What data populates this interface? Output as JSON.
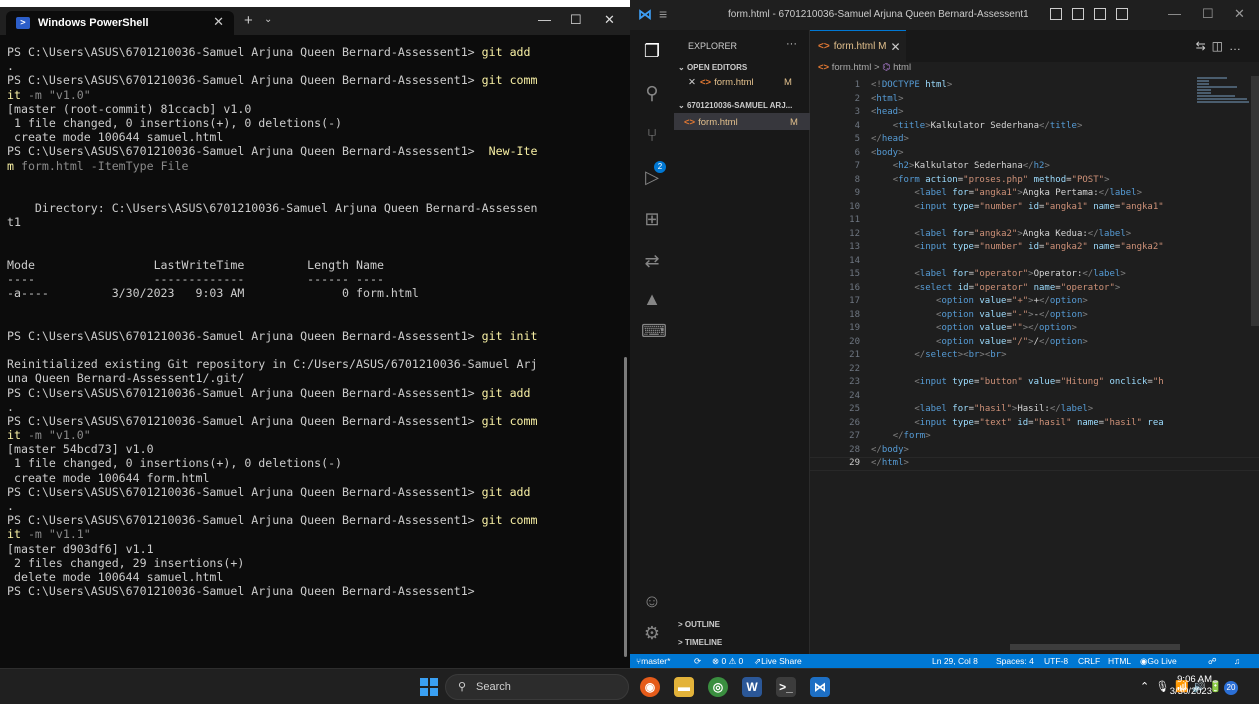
{
  "powershell": {
    "tab_title": "Windows PowerShell",
    "lines": [
      {
        "text": "PS C:\\Users\\ASUS\\6701210036-Samuel Arjuna Queen Bernard-Assessent1> ",
        "cmd": "git add",
        "arg": ""
      },
      {
        "text": ".",
        "cmd": "",
        "arg": ""
      },
      {
        "text": "PS C:\\Users\\ASUS\\6701210036-Samuel Arjuna Queen Bernard-Assessent1> ",
        "cmd": "git comm",
        "arg": ""
      },
      {
        "text": "",
        "cmd": "it",
        "arg": " -m \"v1.0\""
      },
      {
        "text": "[master (root-commit) 81ccacb] v1.0",
        "cmd": "",
        "arg": ""
      },
      {
        "text": " 1 file changed, 0 insertions(+), 0 deletions(-)",
        "cmd": "",
        "arg": ""
      },
      {
        "text": " create mode 100644 samuel.html",
        "cmd": "",
        "arg": ""
      },
      {
        "text": "PS C:\\Users\\ASUS\\6701210036-Samuel Arjuna Queen Bernard-Assessent1> ",
        "cmd": " New-Ite",
        "arg": ""
      },
      {
        "text": "",
        "cmd": "m",
        "arg": " form.html -ItemType File"
      },
      {
        "text": "",
        "cmd": "",
        "arg": ""
      },
      {
        "text": "",
        "cmd": "",
        "arg": ""
      },
      {
        "text": "    Directory: C:\\Users\\ASUS\\6701210036-Samuel Arjuna Queen Bernard-Assessen",
        "cmd": "",
        "arg": ""
      },
      {
        "text": "t1",
        "cmd": "",
        "arg": ""
      },
      {
        "text": "",
        "cmd": "",
        "arg": ""
      },
      {
        "text": "",
        "cmd": "",
        "arg": ""
      },
      {
        "text": "Mode                 LastWriteTime         Length Name",
        "cmd": "",
        "arg": ""
      },
      {
        "text": "----                 -------------         ------ ----",
        "cmd": "",
        "arg": ""
      },
      {
        "text": "-a----         3/30/2023   9:03 AM              0 form.html",
        "cmd": "",
        "arg": ""
      },
      {
        "text": "",
        "cmd": "",
        "arg": ""
      },
      {
        "text": "",
        "cmd": "",
        "arg": ""
      },
      {
        "text": "PS C:\\Users\\ASUS\\6701210036-Samuel Arjuna Queen Bernard-Assessent1> ",
        "cmd": "git init",
        "arg": ""
      },
      {
        "text": "",
        "cmd": "",
        "arg": ""
      },
      {
        "text": "Reinitialized existing Git repository in C:/Users/ASUS/6701210036-Samuel Arj",
        "cmd": "",
        "arg": ""
      },
      {
        "text": "una Queen Bernard-Assessent1/.git/",
        "cmd": "",
        "arg": ""
      },
      {
        "text": "PS C:\\Users\\ASUS\\6701210036-Samuel Arjuna Queen Bernard-Assessent1> ",
        "cmd": "git add",
        "arg": ""
      },
      {
        "text": ".",
        "cmd": "",
        "arg": ""
      },
      {
        "text": "PS C:\\Users\\ASUS\\6701210036-Samuel Arjuna Queen Bernard-Assessent1> ",
        "cmd": "git comm",
        "arg": ""
      },
      {
        "text": "",
        "cmd": "it",
        "arg": " -m \"v1.0\""
      },
      {
        "text": "[master 54bcd73] v1.0",
        "cmd": "",
        "arg": ""
      },
      {
        "text": " 1 file changed, 0 insertions(+), 0 deletions(-)",
        "cmd": "",
        "arg": ""
      },
      {
        "text": " create mode 100644 form.html",
        "cmd": "",
        "arg": ""
      },
      {
        "text": "PS C:\\Users\\ASUS\\6701210036-Samuel Arjuna Queen Bernard-Assessent1> ",
        "cmd": "git add",
        "arg": ""
      },
      {
        "text": ".",
        "cmd": "",
        "arg": ""
      },
      {
        "text": "PS C:\\Users\\ASUS\\6701210036-Samuel Arjuna Queen Bernard-Assessent1> ",
        "cmd": "git comm",
        "arg": ""
      },
      {
        "text": "",
        "cmd": "it",
        "arg": " -m \"v1.1\""
      },
      {
        "text": "[master d903df6] v1.1",
        "cmd": "",
        "arg": ""
      },
      {
        "text": " 2 files changed, 29 insertions(+)",
        "cmd": "",
        "arg": ""
      },
      {
        "text": " delete mode 100644 samuel.html",
        "cmd": "",
        "arg": ""
      },
      {
        "text": "PS C:\\Users\\ASUS\\6701210036-Samuel Arjuna Queen Bernard-Assessent1>",
        "cmd": "",
        "arg": ""
      }
    ]
  },
  "vscode": {
    "window_title": "form.html - 6701210036-Samuel Arjuna Queen Bernard-Assessent1 - ...",
    "explorer_title": "EXPLORER",
    "explorer_more": "···",
    "open_editors": "OPEN EDITORS",
    "folder": "6701210036-SAMUEL ARJ...",
    "open_file": "form.html",
    "open_file_status": "M",
    "folder_file": "form.html",
    "folder_file_status": "M",
    "tab_label": "form.html M",
    "breadcrumb_file": "form.html",
    "breadcrumb_sep": ">",
    "breadcrumb_node": "html",
    "outline": "OUTLINE",
    "timeline": "TIMELINE",
    "scm_badge": "2",
    "code_lines": [
      [
        [
          "n",
          "<!"
        ],
        [
          "t",
          "DOCTYPE"
        ],
        [
          "a",
          " html"
        ],
        [
          "n",
          ">"
        ]
      ],
      [
        [
          "n",
          "<"
        ],
        [
          "t",
          "html"
        ],
        [
          "n",
          ">"
        ]
      ],
      [
        [
          "n",
          "<"
        ],
        [
          "t",
          "head"
        ],
        [
          "n",
          ">"
        ]
      ],
      [
        [
          "tx",
          "    "
        ],
        [
          "n",
          "<"
        ],
        [
          "t",
          "title"
        ],
        [
          "n",
          ">"
        ],
        [
          "tx",
          "Kalkulator Sederhana"
        ],
        [
          "n",
          "</"
        ],
        [
          "t",
          "title"
        ],
        [
          "n",
          ">"
        ]
      ],
      [
        [
          "n",
          "</"
        ],
        [
          "t",
          "head"
        ],
        [
          "n",
          ">"
        ]
      ],
      [
        [
          "n",
          "<"
        ],
        [
          "t",
          "body"
        ],
        [
          "n",
          ">"
        ]
      ],
      [
        [
          "tx",
          "    "
        ],
        [
          "n",
          "<"
        ],
        [
          "t",
          "h2"
        ],
        [
          "n",
          ">"
        ],
        [
          "tx",
          "Kalkulator Sederhana"
        ],
        [
          "n",
          "</"
        ],
        [
          "t",
          "h2"
        ],
        [
          "n",
          ">"
        ]
      ],
      [
        [
          "tx",
          "    "
        ],
        [
          "n",
          "<"
        ],
        [
          "t",
          "form"
        ],
        [
          "a",
          " action"
        ],
        [
          "tx",
          "="
        ],
        [
          "s",
          "\"proses.php\""
        ],
        [
          "a",
          " method"
        ],
        [
          "tx",
          "="
        ],
        [
          "s",
          "\"POST\""
        ],
        [
          "n",
          ">"
        ]
      ],
      [
        [
          "tx",
          "        "
        ],
        [
          "n",
          "<"
        ],
        [
          "t",
          "label"
        ],
        [
          "a",
          " for"
        ],
        [
          "tx",
          "="
        ],
        [
          "s",
          "\"angka1\""
        ],
        [
          "n",
          ">"
        ],
        [
          "tx",
          "Angka Pertama:"
        ],
        [
          "n",
          "</"
        ],
        [
          "t",
          "label"
        ],
        [
          "n",
          ">"
        ]
      ],
      [
        [
          "tx",
          "        "
        ],
        [
          "n",
          "<"
        ],
        [
          "t",
          "input"
        ],
        [
          "a",
          " type"
        ],
        [
          "tx",
          "="
        ],
        [
          "s",
          "\"number\""
        ],
        [
          "a",
          " id"
        ],
        [
          "tx",
          "="
        ],
        [
          "s",
          "\"angka1\""
        ],
        [
          "a",
          " name"
        ],
        [
          "tx",
          "="
        ],
        [
          "s",
          "\"angka1\""
        ]
      ],
      [
        [
          "tx",
          ""
        ]
      ],
      [
        [
          "tx",
          "        "
        ],
        [
          "n",
          "<"
        ],
        [
          "t",
          "label"
        ],
        [
          "a",
          " for"
        ],
        [
          "tx",
          "="
        ],
        [
          "s",
          "\"angka2\""
        ],
        [
          "n",
          ">"
        ],
        [
          "tx",
          "Angka Kedua:"
        ],
        [
          "n",
          "</"
        ],
        [
          "t",
          "label"
        ],
        [
          "n",
          ">"
        ]
      ],
      [
        [
          "tx",
          "        "
        ],
        [
          "n",
          "<"
        ],
        [
          "t",
          "input"
        ],
        [
          "a",
          " type"
        ],
        [
          "tx",
          "="
        ],
        [
          "s",
          "\"number\""
        ],
        [
          "a",
          " id"
        ],
        [
          "tx",
          "="
        ],
        [
          "s",
          "\"angka2\""
        ],
        [
          "a",
          " name"
        ],
        [
          "tx",
          "="
        ],
        [
          "s",
          "\"angka2\""
        ]
      ],
      [
        [
          "tx",
          ""
        ]
      ],
      [
        [
          "tx",
          "        "
        ],
        [
          "n",
          "<"
        ],
        [
          "t",
          "label"
        ],
        [
          "a",
          " for"
        ],
        [
          "tx",
          "="
        ],
        [
          "s",
          "\"operator\""
        ],
        [
          "n",
          ">"
        ],
        [
          "tx",
          "Operator:"
        ],
        [
          "n",
          "</"
        ],
        [
          "t",
          "label"
        ],
        [
          "n",
          ">"
        ]
      ],
      [
        [
          "tx",
          "        "
        ],
        [
          "n",
          "<"
        ],
        [
          "t",
          "select"
        ],
        [
          "a",
          " id"
        ],
        [
          "tx",
          "="
        ],
        [
          "s",
          "\"operator\""
        ],
        [
          "a",
          " name"
        ],
        [
          "tx",
          "="
        ],
        [
          "s",
          "\"operator\""
        ],
        [
          "n",
          ">"
        ]
      ],
      [
        [
          "tx",
          "            "
        ],
        [
          "n",
          "<"
        ],
        [
          "t",
          "option"
        ],
        [
          "a",
          " value"
        ],
        [
          "tx",
          "="
        ],
        [
          "s",
          "\"+\""
        ],
        [
          "n",
          ">"
        ],
        [
          "tx",
          "+"
        ],
        [
          "n",
          "</"
        ],
        [
          "t",
          "option"
        ],
        [
          "n",
          ">"
        ]
      ],
      [
        [
          "tx",
          "            "
        ],
        [
          "n",
          "<"
        ],
        [
          "t",
          "option"
        ],
        [
          "a",
          " value"
        ],
        [
          "tx",
          "="
        ],
        [
          "s",
          "\"-\""
        ],
        [
          "n",
          ">"
        ],
        [
          "tx",
          "-"
        ],
        [
          "n",
          "</"
        ],
        [
          "t",
          "option"
        ],
        [
          "n",
          ">"
        ]
      ],
      [
        [
          "tx",
          "            "
        ],
        [
          "n",
          "<"
        ],
        [
          "t",
          "option"
        ],
        [
          "a",
          " value"
        ],
        [
          "tx",
          "="
        ],
        [
          "s",
          "\"\""
        ],
        [
          "n",
          ">"
        ],
        [
          "n",
          "</"
        ],
        [
          "t",
          "option"
        ],
        [
          "n",
          ">"
        ]
      ],
      [
        [
          "tx",
          "            "
        ],
        [
          "n",
          "<"
        ],
        [
          "t",
          "option"
        ],
        [
          "a",
          " value"
        ],
        [
          "tx",
          "="
        ],
        [
          "s",
          "\"/\""
        ],
        [
          "n",
          ">"
        ],
        [
          "tx",
          "/"
        ],
        [
          "n",
          "</"
        ],
        [
          "t",
          "option"
        ],
        [
          "n",
          ">"
        ]
      ],
      [
        [
          "tx",
          "        "
        ],
        [
          "n",
          "</"
        ],
        [
          "t",
          "select"
        ],
        [
          "n",
          "><"
        ],
        [
          "t",
          "br"
        ],
        [
          "n",
          "><"
        ],
        [
          "t",
          "br"
        ],
        [
          "n",
          ">"
        ]
      ],
      [
        [
          "tx",
          ""
        ]
      ],
      [
        [
          "tx",
          "        "
        ],
        [
          "n",
          "<"
        ],
        [
          "t",
          "input"
        ],
        [
          "a",
          " type"
        ],
        [
          "tx",
          "="
        ],
        [
          "s",
          "\"button\""
        ],
        [
          "a",
          " value"
        ],
        [
          "tx",
          "="
        ],
        [
          "s",
          "\"Hitung\""
        ],
        [
          "a",
          " onclick"
        ],
        [
          "tx",
          "="
        ],
        [
          "s",
          "\"h"
        ]
      ],
      [
        [
          "tx",
          ""
        ]
      ],
      [
        [
          "tx",
          "        "
        ],
        [
          "n",
          "<"
        ],
        [
          "t",
          "label"
        ],
        [
          "a",
          " for"
        ],
        [
          "tx",
          "="
        ],
        [
          "s",
          "\"hasil\""
        ],
        [
          "n",
          ">"
        ],
        [
          "tx",
          "Hasil:"
        ],
        [
          "n",
          "</"
        ],
        [
          "t",
          "label"
        ],
        [
          "n",
          ">"
        ]
      ],
      [
        [
          "tx",
          "        "
        ],
        [
          "n",
          "<"
        ],
        [
          "t",
          "input"
        ],
        [
          "a",
          " type"
        ],
        [
          "tx",
          "="
        ],
        [
          "s",
          "\"text\""
        ],
        [
          "a",
          " id"
        ],
        [
          "tx",
          "="
        ],
        [
          "s",
          "\"hasil\""
        ],
        [
          "a",
          " name"
        ],
        [
          "tx",
          "="
        ],
        [
          "s",
          "\"hasil\""
        ],
        [
          "a",
          " rea"
        ]
      ],
      [
        [
          "tx",
          "    "
        ],
        [
          "n",
          "</"
        ],
        [
          "t",
          "form"
        ],
        [
          "n",
          ">"
        ]
      ],
      [
        [
          "n",
          "</"
        ],
        [
          "t",
          "body"
        ],
        [
          "n",
          ">"
        ]
      ],
      [
        [
          "n",
          "</"
        ],
        [
          "t",
          "html"
        ],
        [
          "n",
          ">"
        ]
      ]
    ],
    "status": {
      "branch": "master*",
      "errors": "⊗ 0 ⚠ 0",
      "live_share": "Live Share",
      "position": "Ln 29, Col 8",
      "spaces": "Spaces: 4",
      "encoding": "UTF-8",
      "eol": "CRLF",
      "language": "HTML",
      "go_live": "Go Live"
    }
  },
  "taskbar": {
    "search_placeholder": "Search",
    "time": "9:06 AM",
    "date": "3/30/2023",
    "notification_count": "20"
  },
  "colors": {
    "accent": "#0078d4",
    "terminal_bg": "#0c0c0c",
    "terminal_cmd": "#f9f1a5",
    "editor_bg": "#1e1e1e"
  }
}
